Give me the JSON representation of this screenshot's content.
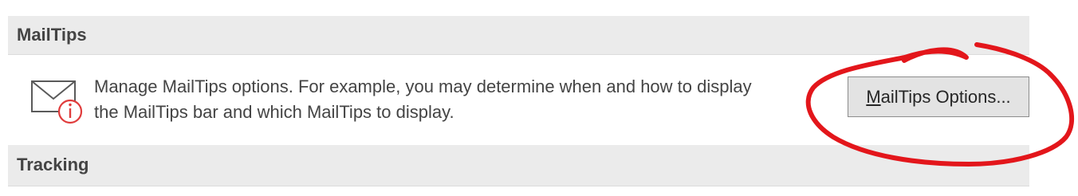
{
  "sections": {
    "mailtips": {
      "title": "MailTips"
    },
    "tracking": {
      "title": "Tracking"
    }
  },
  "mailtips": {
    "icon": "mail-info-icon",
    "description_line1": "Manage MailTips options. For example, you may determine when and how to display",
    "description_line2": "the MailTips bar and which MailTips to display.",
    "button": {
      "accelerator": "M",
      "label_rest": "ailTips Options..."
    }
  },
  "colors": {
    "header_bg": "#ebebeb",
    "text": "#444444",
    "button_bg": "#e3e3e3",
    "button_border": "#8c8c8c",
    "icon_info": "#e03c3c",
    "annotation": "#e3161b"
  }
}
